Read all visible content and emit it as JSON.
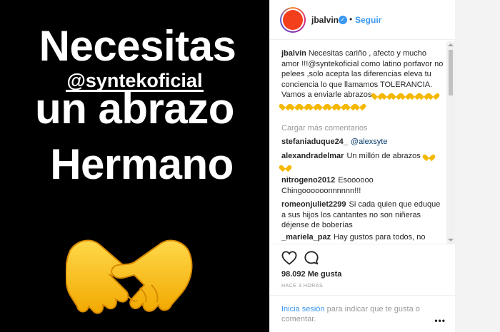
{
  "media": {
    "line1": "Necesitas",
    "handle": "@syntekoficial",
    "line3": "un abrazo",
    "line4": "Hermano",
    "emoji": "handshake-emoji"
  },
  "header": {
    "username": "jbalvin",
    "verified_icon": "verified-badge-icon",
    "separator": "•",
    "follow_label": "Seguir"
  },
  "caption": {
    "username": "jbalvin",
    "text": "Necesitas cariño , afecto y mucho amor !!!@syntekoficial como latino porfavor no pelees ,solo acepta las diferencias eleva tu conciencia lo que llamamos TOLERANCIA. Vamos a enviarle abrazos",
    "heart_count": 16,
    "heart_color": "#f5b800"
  },
  "load_more": "Cargar más comentarios",
  "comments": [
    {
      "user": "stefaniaduque24_",
      "text": "",
      "mention": "@alexsyte"
    },
    {
      "user": "alexandradelmar",
      "text": "Un millón de abrazos",
      "mention": ""
    },
    {
      "user": "nitrogeno2012",
      "text": "Esoooooo Chingoooooonnnnnn!!!",
      "mention": ""
    },
    {
      "user": "romeonjuliet2299",
      "text": "Si cada quien que eduque a sus hijos los cantantes no son niñeras déjense de boberías",
      "mention": ""
    },
    {
      "user": "_mariela_paz",
      "text": "Hay gustos para todos, no",
      "mention": ""
    }
  ],
  "actions": {
    "like_icon": "heart-outline-icon",
    "comment_icon": "comment-bubble-icon",
    "likes": "98.092 Me gusta",
    "time": "HACE 3 HORAS"
  },
  "login": {
    "link": "Inicia sesión",
    "text": "para indicar que te gusta o comentar.",
    "more": "•••"
  },
  "colors": {
    "accent": "#3897f0",
    "avatar": "#f43f1c",
    "media_bg": "#000000"
  }
}
